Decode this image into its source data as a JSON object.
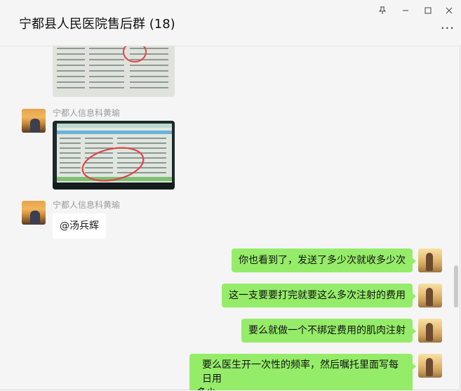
{
  "window": {
    "title": "宁都县人民医院售后群 (18)",
    "controls": {
      "pin": "⊤",
      "minimize": "—",
      "maximize": "☐",
      "close": "✕"
    },
    "more": "···"
  },
  "messages": [
    {
      "type": "image",
      "side": "left",
      "sender": ""
    },
    {
      "type": "image",
      "side": "left",
      "sender": "宁都人信息科黄瑜"
    },
    {
      "type": "text",
      "side": "left",
      "sender": "宁都人信息科黄瑜",
      "text": "@汤兵辉"
    },
    {
      "type": "text",
      "side": "right",
      "text": "你也看到了，发送了多少次就收多少次"
    },
    {
      "type": "text",
      "side": "right",
      "text": "这一支要要打完就要这么多次注射的费用"
    },
    {
      "type": "text",
      "side": "right",
      "text": "要么就做一个不绑定费用的肌肉注射"
    },
    {
      "type": "text",
      "side": "right",
      "text_line1": "要么医生开一次性的频率，然后嘱托里面写每日用",
      "text_line2": "多少"
    }
  ],
  "colors": {
    "background": "#f5f5f5",
    "bubble_self": "#95ec69",
    "bubble_other": "#ffffff",
    "sender_name": "#9a9a9a"
  }
}
